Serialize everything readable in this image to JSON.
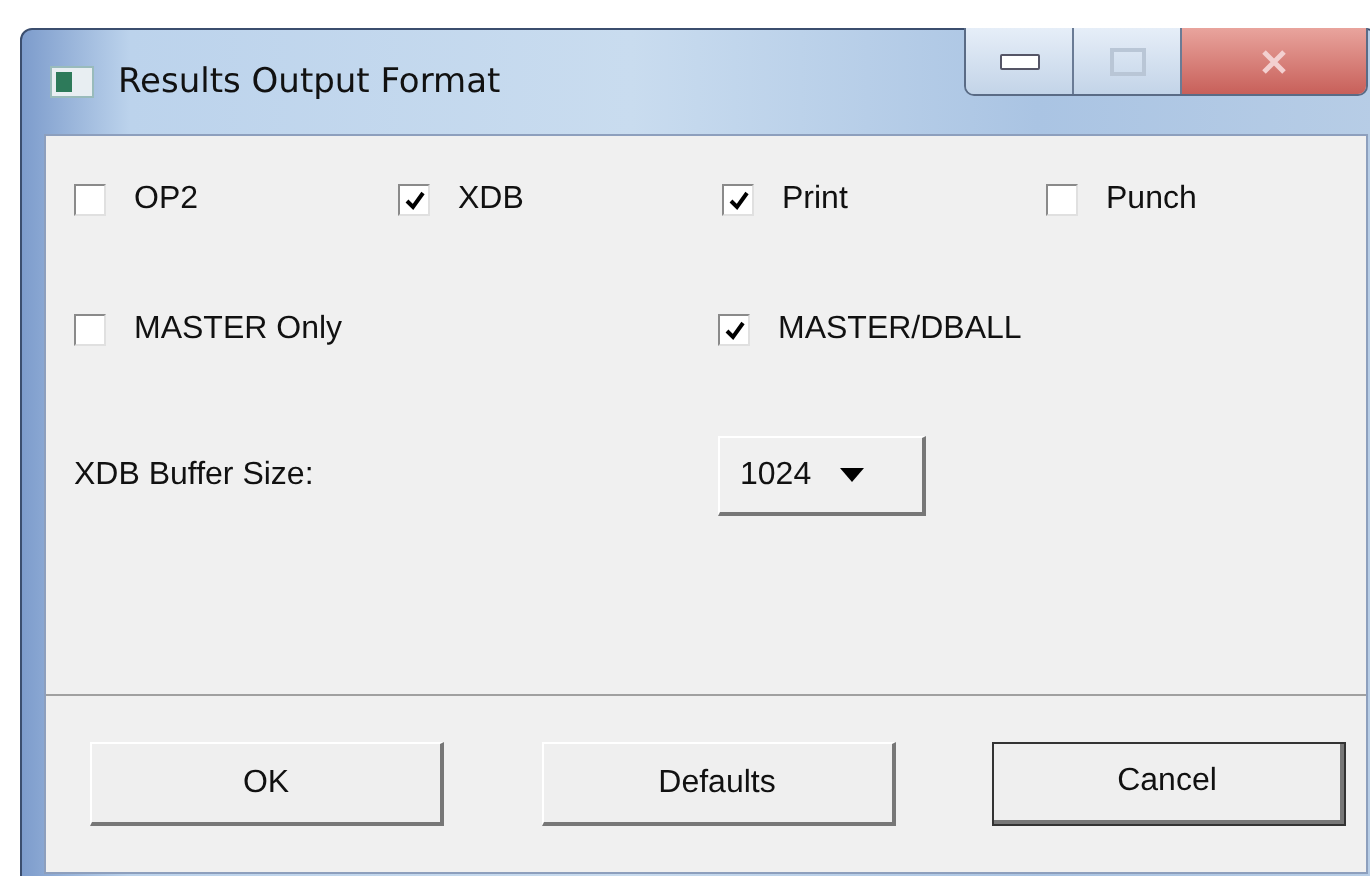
{
  "window": {
    "title": "Results Output Format"
  },
  "option_rows": [
    [
      {
        "label": "OP2",
        "checked": false
      },
      {
        "label": "XDB",
        "checked": true
      },
      {
        "label": "Print",
        "checked": true
      },
      {
        "label": "Punch",
        "checked": false
      }
    ],
    [
      {
        "label": "MASTER Only",
        "checked": false
      },
      {
        "label": "MASTER/DBALL",
        "checked": true
      }
    ]
  ],
  "buffer": {
    "label": "XDB Buffer Size:",
    "value": "1024"
  },
  "buttons": [
    {
      "label": "OK",
      "default": false
    },
    {
      "label": "Defaults",
      "default": false
    },
    {
      "label": "Cancel",
      "default": true
    }
  ]
}
